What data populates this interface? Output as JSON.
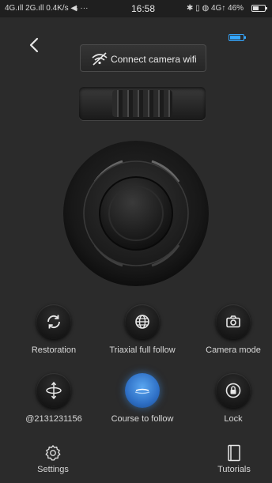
{
  "status_bar": {
    "left": "4G.ıll 2G.ıll 0.4K/s ◀ᵢ ···",
    "time": "16:58",
    "right": "✱ ▯ ◍ 4G↑ 46%"
  },
  "wifi": {
    "label": "Connect camera wifi"
  },
  "controls": {
    "restoration": "Restoration",
    "triaxial": "Triaxial full follow",
    "camera_mode": "Camera mode",
    "account": "@2131231156",
    "course": "Course to follow",
    "lock": "Lock"
  },
  "bottom": {
    "settings": "Settings",
    "tutorials": "Tutorials"
  },
  "colors": {
    "accent": "#35a7ff",
    "background": "#2b2b2b"
  }
}
